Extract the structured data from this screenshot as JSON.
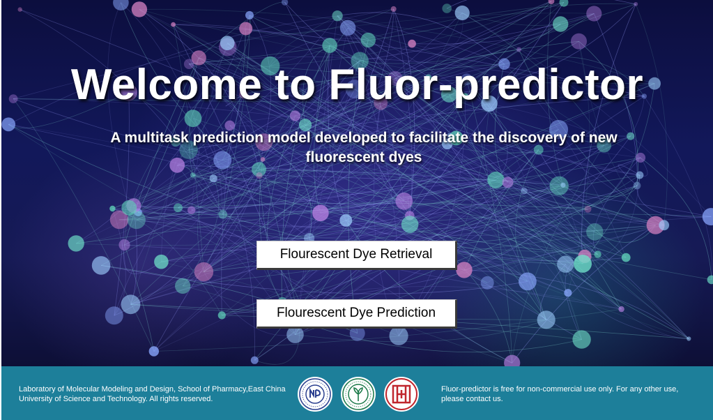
{
  "hero": {
    "title": "Welcome to Fluor-predictor",
    "subtitle": "A multitask prediction model developed to facilitate the discovery of new fluorescent dyes"
  },
  "buttons": {
    "retrieval_label": "Flourescent Dye Retrieval",
    "prediction_label": "Flourescent Dye Prediction"
  },
  "footer": {
    "left_text": "Laboratory of Molecular Modeling and Design, School of Pharmacy,East China University of Science and Technology. All rights reserved.",
    "right_text": "Fluor-predictor is free for non-commercial use only. For any other use, please contact us.",
    "background_color": "#1d7f9a"
  },
  "logos": [
    "ecust-logo",
    "school-of-pharmacy-logo",
    "lab-logo"
  ]
}
